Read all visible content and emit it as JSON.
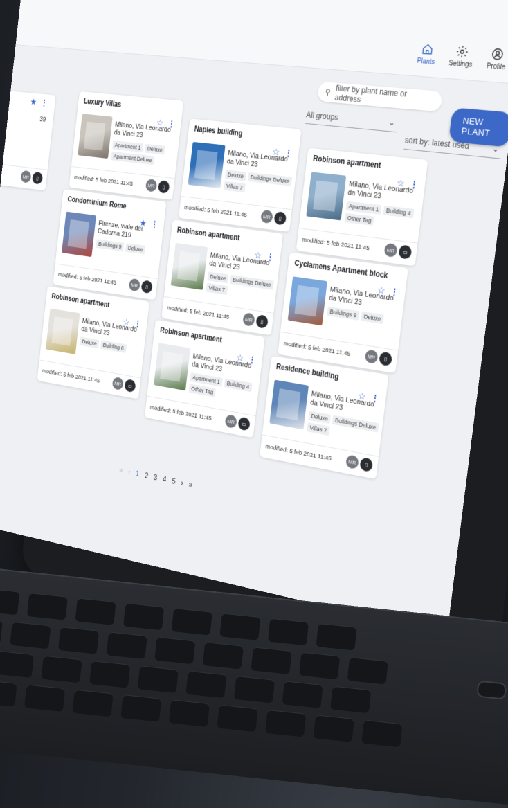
{
  "nav": [
    {
      "label": "Plants",
      "icon": "home-icon",
      "active": true
    },
    {
      "label": "Settings",
      "icon": "gear-icon",
      "active": false
    },
    {
      "label": "Profile",
      "icon": "user-icon",
      "active": false
    }
  ],
  "search": {
    "placeholder": "filter by plant name or address"
  },
  "new_plant_label": "NEW PLANT",
  "groups_select": {
    "value": "All groups"
  },
  "sort_select": {
    "value": "sort by: latest used"
  },
  "cards": [
    {
      "title": "Luxury Villas",
      "address": "Milano, Via Leonardo da Vinci 23",
      "tags": [
        "Apartment 1",
        "Deluxe",
        "Apartment Deluxe"
      ],
      "modified": "modified: 5 feb 2021 11:45",
      "starred": false,
      "device": "phone"
    },
    {
      "title": "Naples building",
      "address": "Milano, Via Leonardo da Vinci 23",
      "tags": [
        "Deluxe",
        "Buildings Deluxe",
        "Villas 7"
      ],
      "modified": "modified: 5 feb 2021 11:45",
      "starred": false,
      "device": "phone"
    },
    {
      "title": "Robinson apartment",
      "address": "Milano, Via Leonardo da Vinci 23",
      "tags": [
        "Apartment 1",
        "Building 4",
        "Other Tag"
      ],
      "modified": "modified: 5 feb 2021 11:45",
      "starred": false,
      "device": "monitor"
    },
    {
      "title": "Condominium Rome",
      "address": "Firenze, viale dei Cadorna 219",
      "tags": [
        "Buildings 9",
        "Deluxe"
      ],
      "modified": "modified: 5 feb 2021 11:45",
      "starred": true,
      "device": "phone"
    },
    {
      "title": "Robinson apartment",
      "address": "Milano, Via Leonardo da Vinci 23",
      "tags": [
        "Deluxe",
        "Buildings Deluxe",
        "Villas 7"
      ],
      "modified": "modified: 5 feb 2021 11:45",
      "starred": false,
      "device": "phone"
    },
    {
      "title": "Cyclamens Apartment block",
      "address": "Milano, Via Leonardo da Vinci 23",
      "tags": [
        "Buildings 9",
        "Deluxe"
      ],
      "modified": "modified: 5 feb 2021 11:45",
      "starred": false,
      "device": "phone"
    },
    {
      "title": "Robinson apartment",
      "address": "Milano, Via Leonardo da Vinci 23",
      "tags": [
        "Deluxe",
        "Building 6"
      ],
      "modified": "modified: 5 feb 2021 11:45",
      "starred": false,
      "device": "monitor"
    },
    {
      "title": "Robinson apartment",
      "address": "Milano, Via Leonardo da Vinci 23",
      "tags": [
        "Apartment 1",
        "Building 4",
        "Other Tag"
      ],
      "modified": "modified: 5 feb 2021 11:45",
      "starred": false,
      "device": "monitor"
    },
    {
      "title": "Residence building",
      "address": "Milano, Via Leonardo da Vinci 23",
      "tags": [
        "Deluxe",
        "Buildings Deluxe",
        "Villas 7"
      ],
      "modified": "modified: 5 feb 2021 11:45",
      "starred": false,
      "device": "phone"
    }
  ],
  "badge_label": "MR",
  "partial_left": {
    "fragment_top": "39"
  },
  "pagination": {
    "first": "«",
    "prev": "‹",
    "pages": [
      "1",
      "2",
      "3",
      "4",
      "5"
    ],
    "current": "1",
    "next": "›",
    "last": "»"
  },
  "colors": {
    "accent": "#3c68c8",
    "background": "#eef0f3"
  }
}
